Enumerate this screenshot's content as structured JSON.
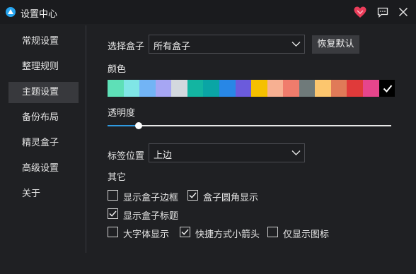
{
  "window": {
    "title": "设置中心"
  },
  "sidebar": {
    "items": [
      {
        "label": "常规设置",
        "active": false
      },
      {
        "label": "整理规则",
        "active": false
      },
      {
        "label": "主题设置",
        "active": true
      },
      {
        "label": "备份布局",
        "active": false
      },
      {
        "label": "精灵盒子",
        "active": false
      },
      {
        "label": "高级设置",
        "active": false
      },
      {
        "label": "关于",
        "active": false
      }
    ]
  },
  "theme": {
    "box_select": {
      "label": "选择盒子",
      "value": "所有盒子"
    },
    "reset_button": "恢复默认",
    "color_label": "颜色",
    "colors": [
      "#5ee0b7",
      "#80e6e6",
      "#72b4f5",
      "#a6a6f3",
      "#d3d8de",
      "#13b5a1",
      "#0aa5a5",
      "#2887e6",
      "#6b5bdc",
      "#f5c000",
      "#f7b092",
      "#f07c6c",
      "#6f7a7a",
      "#fcc66e",
      "#e07a58",
      "#e03a3a",
      "#e6458c",
      "#000000"
    ],
    "selected_color_index": 17,
    "opacity": {
      "label": "透明度",
      "value": 0.11
    },
    "tab_position": {
      "label": "标签位置",
      "value": "上边"
    },
    "other_label": "其它",
    "checkboxes": [
      {
        "label": "显示盒子边框",
        "checked": false
      },
      {
        "label": "盒子圆角显示",
        "checked": true
      },
      {
        "label": "显示盒子标题",
        "checked": true
      },
      {
        "label": "大字体显示",
        "checked": false
      },
      {
        "label": "快捷方式小箭头",
        "checked": true
      },
      {
        "label": "仅显示图标",
        "checked": false
      }
    ]
  },
  "icons": {
    "app": "app-logo-icon",
    "heart": "heart-icon",
    "feedback": "chat-icon",
    "close": "close-icon"
  }
}
